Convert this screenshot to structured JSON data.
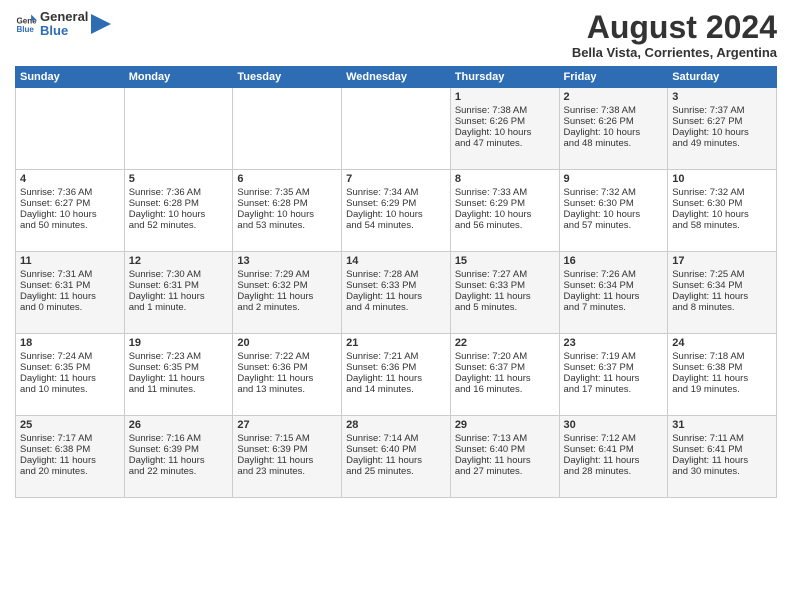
{
  "header": {
    "logo_general": "General",
    "logo_blue": "Blue",
    "month_year": "August 2024",
    "location": "Bella Vista, Corrientes, Argentina"
  },
  "weekdays": [
    "Sunday",
    "Monday",
    "Tuesday",
    "Wednesday",
    "Thursday",
    "Friday",
    "Saturday"
  ],
  "weeks": [
    [
      {
        "day": "",
        "content": ""
      },
      {
        "day": "",
        "content": ""
      },
      {
        "day": "",
        "content": ""
      },
      {
        "day": "",
        "content": ""
      },
      {
        "day": "1",
        "content": "Sunrise: 7:38 AM\nSunset: 6:26 PM\nDaylight: 10 hours\nand 47 minutes."
      },
      {
        "day": "2",
        "content": "Sunrise: 7:38 AM\nSunset: 6:26 PM\nDaylight: 10 hours\nand 48 minutes."
      },
      {
        "day": "3",
        "content": "Sunrise: 7:37 AM\nSunset: 6:27 PM\nDaylight: 10 hours\nand 49 minutes."
      }
    ],
    [
      {
        "day": "4",
        "content": "Sunrise: 7:36 AM\nSunset: 6:27 PM\nDaylight: 10 hours\nand 50 minutes."
      },
      {
        "day": "5",
        "content": "Sunrise: 7:36 AM\nSunset: 6:28 PM\nDaylight: 10 hours\nand 52 minutes."
      },
      {
        "day": "6",
        "content": "Sunrise: 7:35 AM\nSunset: 6:28 PM\nDaylight: 10 hours\nand 53 minutes."
      },
      {
        "day": "7",
        "content": "Sunrise: 7:34 AM\nSunset: 6:29 PM\nDaylight: 10 hours\nand 54 minutes."
      },
      {
        "day": "8",
        "content": "Sunrise: 7:33 AM\nSunset: 6:29 PM\nDaylight: 10 hours\nand 56 minutes."
      },
      {
        "day": "9",
        "content": "Sunrise: 7:32 AM\nSunset: 6:30 PM\nDaylight: 10 hours\nand 57 minutes."
      },
      {
        "day": "10",
        "content": "Sunrise: 7:32 AM\nSunset: 6:30 PM\nDaylight: 10 hours\nand 58 minutes."
      }
    ],
    [
      {
        "day": "11",
        "content": "Sunrise: 7:31 AM\nSunset: 6:31 PM\nDaylight: 11 hours\nand 0 minutes."
      },
      {
        "day": "12",
        "content": "Sunrise: 7:30 AM\nSunset: 6:31 PM\nDaylight: 11 hours\nand 1 minute."
      },
      {
        "day": "13",
        "content": "Sunrise: 7:29 AM\nSunset: 6:32 PM\nDaylight: 11 hours\nand 2 minutes."
      },
      {
        "day": "14",
        "content": "Sunrise: 7:28 AM\nSunset: 6:33 PM\nDaylight: 11 hours\nand 4 minutes."
      },
      {
        "day": "15",
        "content": "Sunrise: 7:27 AM\nSunset: 6:33 PM\nDaylight: 11 hours\nand 5 minutes."
      },
      {
        "day": "16",
        "content": "Sunrise: 7:26 AM\nSunset: 6:34 PM\nDaylight: 11 hours\nand 7 minutes."
      },
      {
        "day": "17",
        "content": "Sunrise: 7:25 AM\nSunset: 6:34 PM\nDaylight: 11 hours\nand 8 minutes."
      }
    ],
    [
      {
        "day": "18",
        "content": "Sunrise: 7:24 AM\nSunset: 6:35 PM\nDaylight: 11 hours\nand 10 minutes."
      },
      {
        "day": "19",
        "content": "Sunrise: 7:23 AM\nSunset: 6:35 PM\nDaylight: 11 hours\nand 11 minutes."
      },
      {
        "day": "20",
        "content": "Sunrise: 7:22 AM\nSunset: 6:36 PM\nDaylight: 11 hours\nand 13 minutes."
      },
      {
        "day": "21",
        "content": "Sunrise: 7:21 AM\nSunset: 6:36 PM\nDaylight: 11 hours\nand 14 minutes."
      },
      {
        "day": "22",
        "content": "Sunrise: 7:20 AM\nSunset: 6:37 PM\nDaylight: 11 hours\nand 16 minutes."
      },
      {
        "day": "23",
        "content": "Sunrise: 7:19 AM\nSunset: 6:37 PM\nDaylight: 11 hours\nand 17 minutes."
      },
      {
        "day": "24",
        "content": "Sunrise: 7:18 AM\nSunset: 6:38 PM\nDaylight: 11 hours\nand 19 minutes."
      }
    ],
    [
      {
        "day": "25",
        "content": "Sunrise: 7:17 AM\nSunset: 6:38 PM\nDaylight: 11 hours\nand 20 minutes."
      },
      {
        "day": "26",
        "content": "Sunrise: 7:16 AM\nSunset: 6:39 PM\nDaylight: 11 hours\nand 22 minutes."
      },
      {
        "day": "27",
        "content": "Sunrise: 7:15 AM\nSunset: 6:39 PM\nDaylight: 11 hours\nand 23 minutes."
      },
      {
        "day": "28",
        "content": "Sunrise: 7:14 AM\nSunset: 6:40 PM\nDaylight: 11 hours\nand 25 minutes."
      },
      {
        "day": "29",
        "content": "Sunrise: 7:13 AM\nSunset: 6:40 PM\nDaylight: 11 hours\nand 27 minutes."
      },
      {
        "day": "30",
        "content": "Sunrise: 7:12 AM\nSunset: 6:41 PM\nDaylight: 11 hours\nand 28 minutes."
      },
      {
        "day": "31",
        "content": "Sunrise: 7:11 AM\nSunset: 6:41 PM\nDaylight: 11 hours\nand 30 minutes."
      }
    ]
  ]
}
